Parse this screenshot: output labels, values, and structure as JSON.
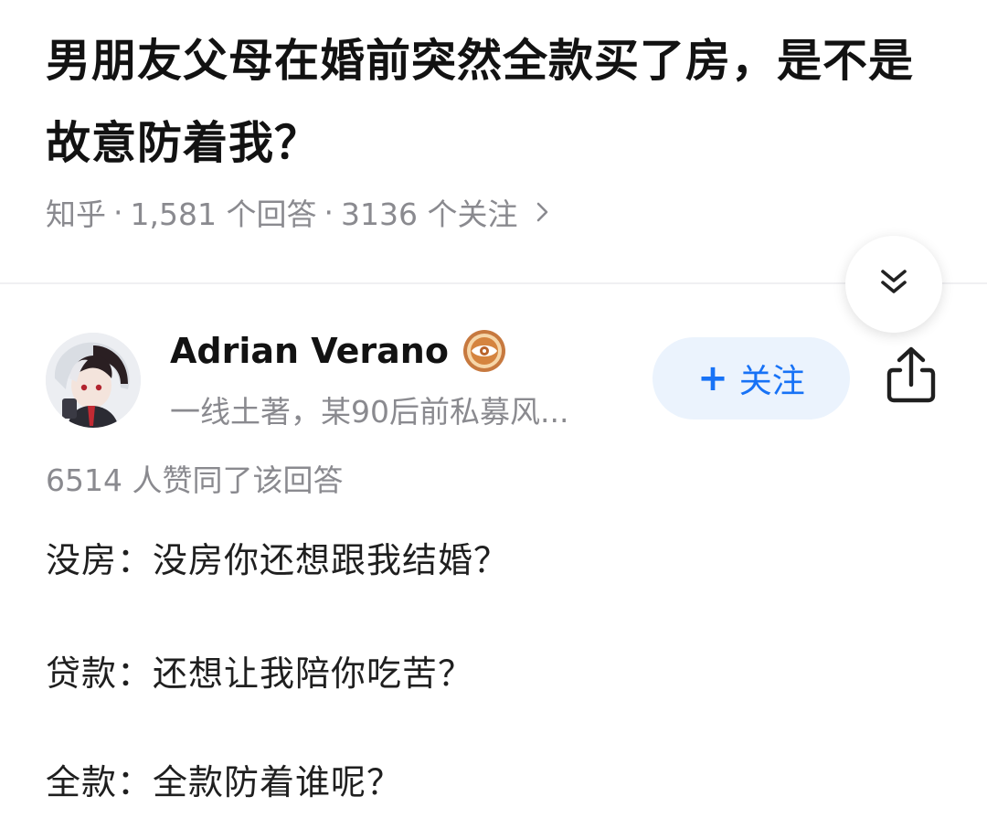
{
  "question": {
    "title": "男朋友父母在婚前突然全款买了房，是不是故意防着我？",
    "source": "知乎",
    "separator": "·",
    "answers_count": "1,581 个回答",
    "followers_count": "3136 个关注"
  },
  "author": {
    "name": "Adrian Verano",
    "bio": "一线土著，某90后前私募风...",
    "badge_icon": "certified-badge-icon"
  },
  "actions": {
    "follow_plus": "+",
    "follow_label": "关注",
    "collapse_icon": "double-chevron-down-icon",
    "share_icon": "share-icon"
  },
  "answer": {
    "votes": "6514 人赞同了该回答",
    "lines": [
      "没房：没房你还想跟我结婚？",
      "贷款：还想让我陪你吃苦？",
      "全款：全款防着谁呢？"
    ]
  },
  "colors": {
    "accent": "#1772f6",
    "follow_bg": "#ebf3fd",
    "meta_text": "#8a8a8f"
  }
}
